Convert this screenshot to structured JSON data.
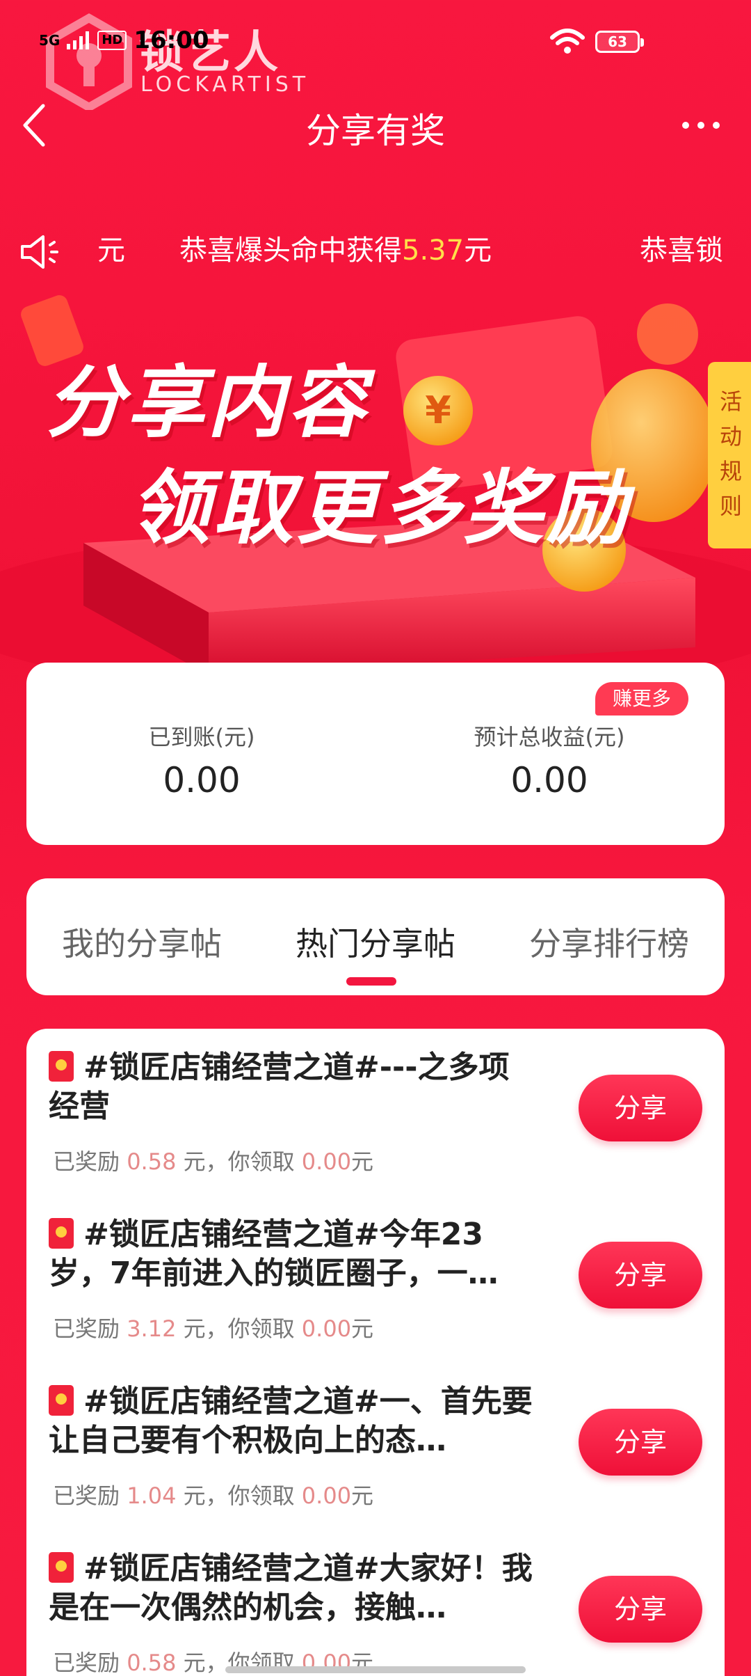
{
  "status_bar": {
    "network": "5G",
    "hd": "HD",
    "time": "16:00",
    "battery": "63",
    "watermark_text": "锁艺人",
    "watermark_sub": "LOCKARTIST"
  },
  "nav": {
    "title": "分享有奖",
    "back_icon": "chevron-left-icon",
    "more_icon": "more-horizontal-icon",
    "more_label": "•••"
  },
  "ticker": {
    "icon": "speaker-icon",
    "items": [
      {
        "prefix": "元",
        "amount": "",
        "suffix": ""
      },
      {
        "prefix": "恭喜爆头命中获得",
        "amount": "5.37",
        "suffix": "元"
      },
      {
        "prefix": "恭喜锁",
        "amount": "",
        "suffix": ""
      }
    ]
  },
  "banner": {
    "line1": "分享内容",
    "line2": "领取更多奖励",
    "rules_tab": "活动规则"
  },
  "earnings": {
    "badge": "赚更多",
    "received_label": "已到账(元)",
    "received_value": "0.00",
    "estimated_label": "预计总收益(元)",
    "estimated_value": "0.00"
  },
  "tabs": [
    {
      "label": "我的分享帖",
      "active": false
    },
    {
      "label": "热门分享帖",
      "active": true
    },
    {
      "label": "分享排行榜",
      "active": false
    }
  ],
  "posts": [
    {
      "title": "#锁匠店铺经营之道#---之多项经营",
      "rewarded_prefix": "已奖励",
      "rewarded": "0.58",
      "rewarded_unit": "元，你领取",
      "claimed": "0.00",
      "claimed_unit": "元",
      "button": "分享"
    },
    {
      "title": "#锁匠店铺经营之道#今年23岁，7年前进入的锁匠圈子，一…",
      "rewarded_prefix": "已奖励",
      "rewarded": "3.12",
      "rewarded_unit": "元，你领取",
      "claimed": "0.00",
      "claimed_unit": "元",
      "button": "分享"
    },
    {
      "title": "#锁匠店铺经营之道#一、首先要让自己要有个积极向上的态…",
      "rewarded_prefix": "已奖励",
      "rewarded": "1.04",
      "rewarded_unit": "元，你领取",
      "claimed": "0.00",
      "claimed_unit": "元",
      "button": "分享"
    },
    {
      "title": "#锁匠店铺经营之道#大家好！我是在一次偶然的机会，接触…",
      "rewarded_prefix": "已奖励",
      "rewarded": "0.58",
      "rewarded_unit": "元，你领取",
      "claimed": "0.00",
      "claimed_unit": "元",
      "button": "分享"
    }
  ],
  "colors": {
    "primary_red": "#f3163f",
    "amount_yellow": "#ffe04a",
    "rules_tab_bg": "#ffcf3f",
    "reward_amount": "#e58a8a"
  }
}
